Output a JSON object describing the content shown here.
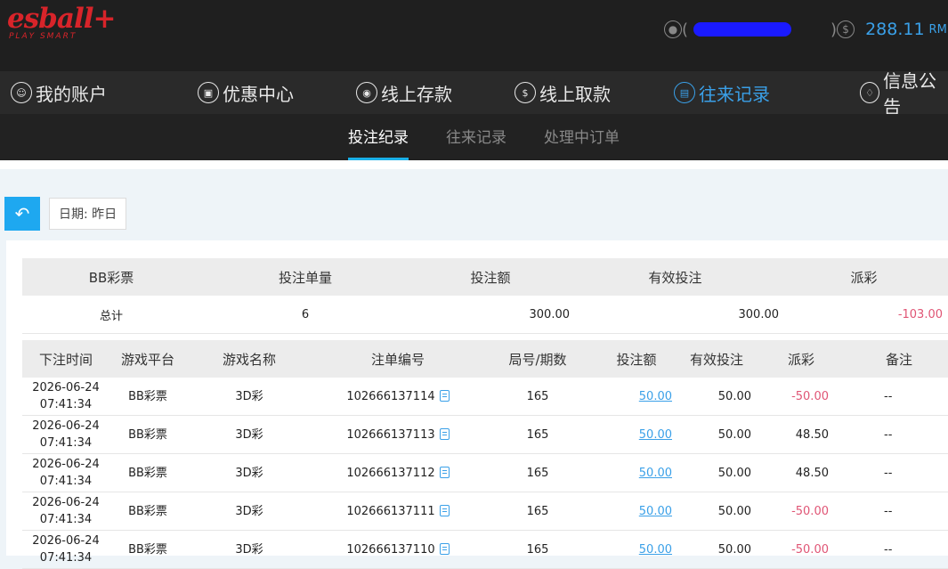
{
  "header": {
    "logo_text": "esball+",
    "logo_tagline": "PLAY SMART",
    "balance": "288.11",
    "balance_unit": "RM"
  },
  "nav": [
    {
      "label": "我的账户"
    },
    {
      "label": "优惠中心"
    },
    {
      "label": "线上存款"
    },
    {
      "label": "线上取款"
    },
    {
      "label": "往来记录"
    },
    {
      "label": "信息公告"
    }
  ],
  "subtabs": [
    {
      "label": "投注纪录"
    },
    {
      "label": "往来记录"
    },
    {
      "label": "处理中订单"
    }
  ],
  "filter": {
    "date_label": "日期: 昨日"
  },
  "colors": {
    "accent": "#1ea8f0",
    "negative": "#e05575",
    "brand": "#d8242a"
  },
  "summary": {
    "headers": [
      "BB彩票",
      "投注单量",
      "投注额",
      "有效投注",
      "派彩"
    ],
    "row": [
      "总计",
      "6",
      "300.00",
      "300.00",
      "-103.00"
    ]
  },
  "records": {
    "headers": [
      "下注时间",
      "游戏平台",
      "游戏名称",
      "注单编号",
      "局号/期数",
      "投注额",
      "有效投注",
      "派彩",
      "备注"
    ],
    "rows": [
      {
        "date": "2026-06-24",
        "time": "07:41:34",
        "platform": "BB彩票",
        "game": "3D彩",
        "id": "102666137114",
        "round": "165",
        "bet": "50.00",
        "valid": "50.00",
        "payout": "-50.00",
        "note": "--"
      },
      {
        "date": "2026-06-24",
        "time": "07:41:34",
        "platform": "BB彩票",
        "game": "3D彩",
        "id": "102666137113",
        "round": "165",
        "bet": "50.00",
        "valid": "50.00",
        "payout": "48.50",
        "note": "--"
      },
      {
        "date": "2026-06-24",
        "time": "07:41:34",
        "platform": "BB彩票",
        "game": "3D彩",
        "id": "102666137112",
        "round": "165",
        "bet": "50.00",
        "valid": "50.00",
        "payout": "48.50",
        "note": "--"
      },
      {
        "date": "2026-06-24",
        "time": "07:41:34",
        "platform": "BB彩票",
        "game": "3D彩",
        "id": "102666137111",
        "round": "165",
        "bet": "50.00",
        "valid": "50.00",
        "payout": "-50.00",
        "note": "--"
      },
      {
        "date": "2026-06-24",
        "time": "07:41:34",
        "platform": "BB彩票",
        "game": "3D彩",
        "id": "102666137110",
        "round": "165",
        "bet": "50.00",
        "valid": "50.00",
        "payout": "-50.00",
        "note": "--"
      }
    ]
  }
}
